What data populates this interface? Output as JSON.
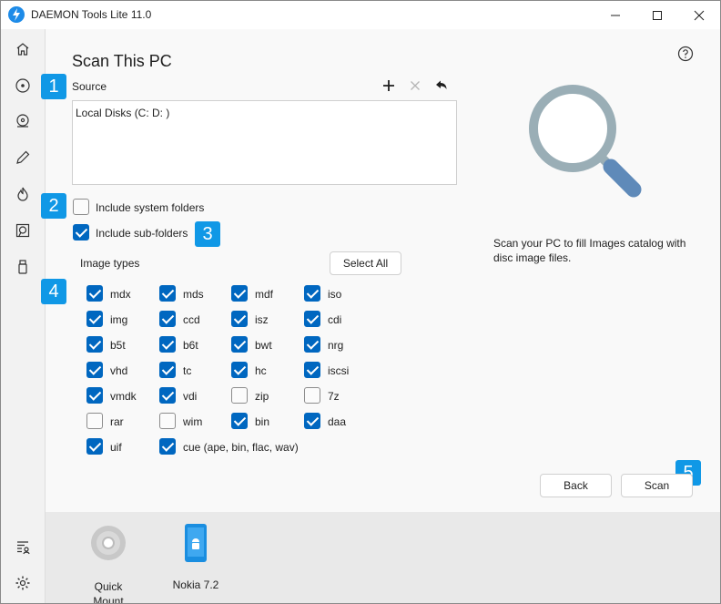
{
  "window": {
    "title": "DAEMON Tools Lite 11.0",
    "accent": "#0067c0",
    "badge_color": "#1098e6",
    "controls": [
      "minimize-icon",
      "maximize-icon",
      "close-icon"
    ]
  },
  "sidebar": {
    "items": [
      "home-icon",
      "disc-icon",
      "disc-image-icon",
      "pencil-icon",
      "flame-icon",
      "device-image-icon",
      "usb-icon"
    ],
    "bottom_items": [
      "license-icon",
      "gear-icon"
    ]
  },
  "page": {
    "title": "Scan This PC",
    "help_icon": "help-icon"
  },
  "badges": [
    "1",
    "2",
    "3",
    "4",
    "5"
  ],
  "source": {
    "label": "Source",
    "value": "Local Disks (C: D: )",
    "tools": [
      "plus-icon",
      "remove-icon",
      "undo-icon"
    ]
  },
  "options": {
    "system_folders": {
      "label": "Include system folders",
      "checked": false
    },
    "sub_folders": {
      "label": "Include sub-folders",
      "checked": true
    }
  },
  "image_types": {
    "label": "Image types",
    "select_all": "Select All",
    "items": [
      {
        "name": "mdx",
        "checked": true
      },
      {
        "name": "mds",
        "checked": true
      },
      {
        "name": "mdf",
        "checked": true
      },
      {
        "name": "iso",
        "checked": true
      },
      {
        "name": "img",
        "checked": true
      },
      {
        "name": "ccd",
        "checked": true
      },
      {
        "name": "isz",
        "checked": true
      },
      {
        "name": "cdi",
        "checked": true
      },
      {
        "name": "b5t",
        "checked": true
      },
      {
        "name": "b6t",
        "checked": true
      },
      {
        "name": "bwt",
        "checked": true
      },
      {
        "name": "nrg",
        "checked": true
      },
      {
        "name": "vhd",
        "checked": true
      },
      {
        "name": "tc",
        "checked": true
      },
      {
        "name": "hc",
        "checked": true
      },
      {
        "name": "iscsi",
        "checked": true
      },
      {
        "name": "vmdk",
        "checked": true
      },
      {
        "name": "vdi",
        "checked": true
      },
      {
        "name": "zip",
        "checked": false
      },
      {
        "name": "7z",
        "checked": false
      },
      {
        "name": "rar",
        "checked": false
      },
      {
        "name": "wim",
        "checked": false
      },
      {
        "name": "bin",
        "checked": true
      },
      {
        "name": "daa",
        "checked": true
      },
      {
        "name": "uif",
        "checked": true
      },
      {
        "name": "cue (ape, bin, flac, wav)",
        "checked": true
      }
    ]
  },
  "hint": "Scan your PC to fill Images catalog with disc image files.",
  "hero_icon": "magnifier-icon",
  "actions": {
    "back": "Back",
    "scan": "Scan"
  },
  "devices": [
    {
      "label_line1": "Quick",
      "label_line2": "Mount",
      "icon": "quick-mount-icon"
    },
    {
      "label_line1": "Nokia 7.2",
      "label_line2": "",
      "icon": "android-phone-icon"
    }
  ]
}
